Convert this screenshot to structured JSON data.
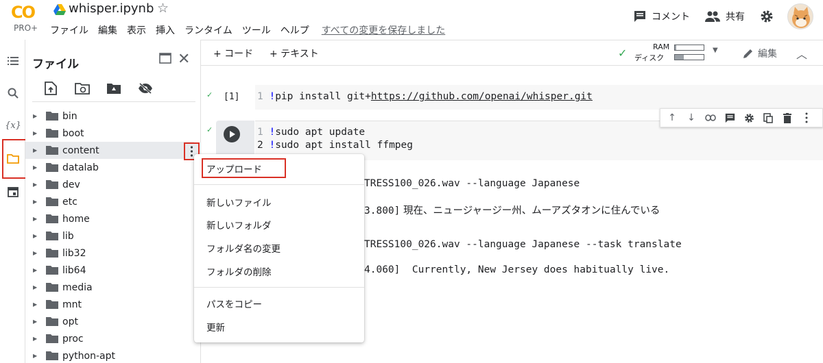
{
  "header": {
    "logo_text": "CO",
    "logo_sub": "PRO+",
    "notebook_title": "whisper.ipynb",
    "menu": [
      "ファイル",
      "編集",
      "表示",
      "挿入",
      "ランタイム",
      "ツール",
      "ヘルプ"
    ],
    "saved_status": "すべての変更を保存しました",
    "comment_label": "コメント",
    "share_label": "共有"
  },
  "file_panel": {
    "title": "ファイル",
    "items": [
      {
        "name": "bin"
      },
      {
        "name": "boot"
      },
      {
        "name": "content"
      },
      {
        "name": "datalab"
      },
      {
        "name": "dev"
      },
      {
        "name": "etc"
      },
      {
        "name": "home"
      },
      {
        "name": "lib"
      },
      {
        "name": "lib32"
      },
      {
        "name": "lib64"
      },
      {
        "name": "media"
      },
      {
        "name": "mnt"
      },
      {
        "name": "opt"
      },
      {
        "name": "proc"
      },
      {
        "name": "python-apt"
      }
    ]
  },
  "toolbar": {
    "add_code": "+ コード",
    "add_text": "+ テキスト",
    "ram_label": "RAM",
    "disk_label": "ディスク",
    "ram_usage": 0.05,
    "disk_usage": 0.3,
    "edit_label": "編集"
  },
  "cells": {
    "cell1": {
      "exec_label": "[1]",
      "lines": [
        {
          "n": "1",
          "bang": "!",
          "cmd": "pip install git+",
          "url": "https://github.com/openai/whisper.git"
        }
      ]
    },
    "cell2": {
      "lines": [
        {
          "n": "1",
          "bang": "!",
          "cmd": "sudo apt update"
        },
        {
          "n": "2",
          "bang": "!",
          "cmd": "sudo apt install ffmpeg"
        }
      ]
    }
  },
  "outputs": {
    "l1": "TRESS100_026.wav --language Japanese",
    "l2_prefix": "3.800]",
    "l2_text": "現在、ニュージャージー州、ムーアズタオンに住んでいる",
    "l3": "TRESS100_026.wav --language Japanese --task translate",
    "l4_prefix": "4.060]",
    "l4_text": "Currently, New Jersey does habitually live."
  },
  "context_menu": {
    "upload": "アップロード",
    "new_file": "新しいファイル",
    "new_folder": "新しいフォルダ",
    "rename": "フォルダ名の変更",
    "delete": "フォルダの削除",
    "copy_path": "パスをコピー",
    "refresh": "更新"
  },
  "colors": {
    "highlight": "#d93025",
    "check": "#34a853",
    "logo": "#f9ab00"
  }
}
